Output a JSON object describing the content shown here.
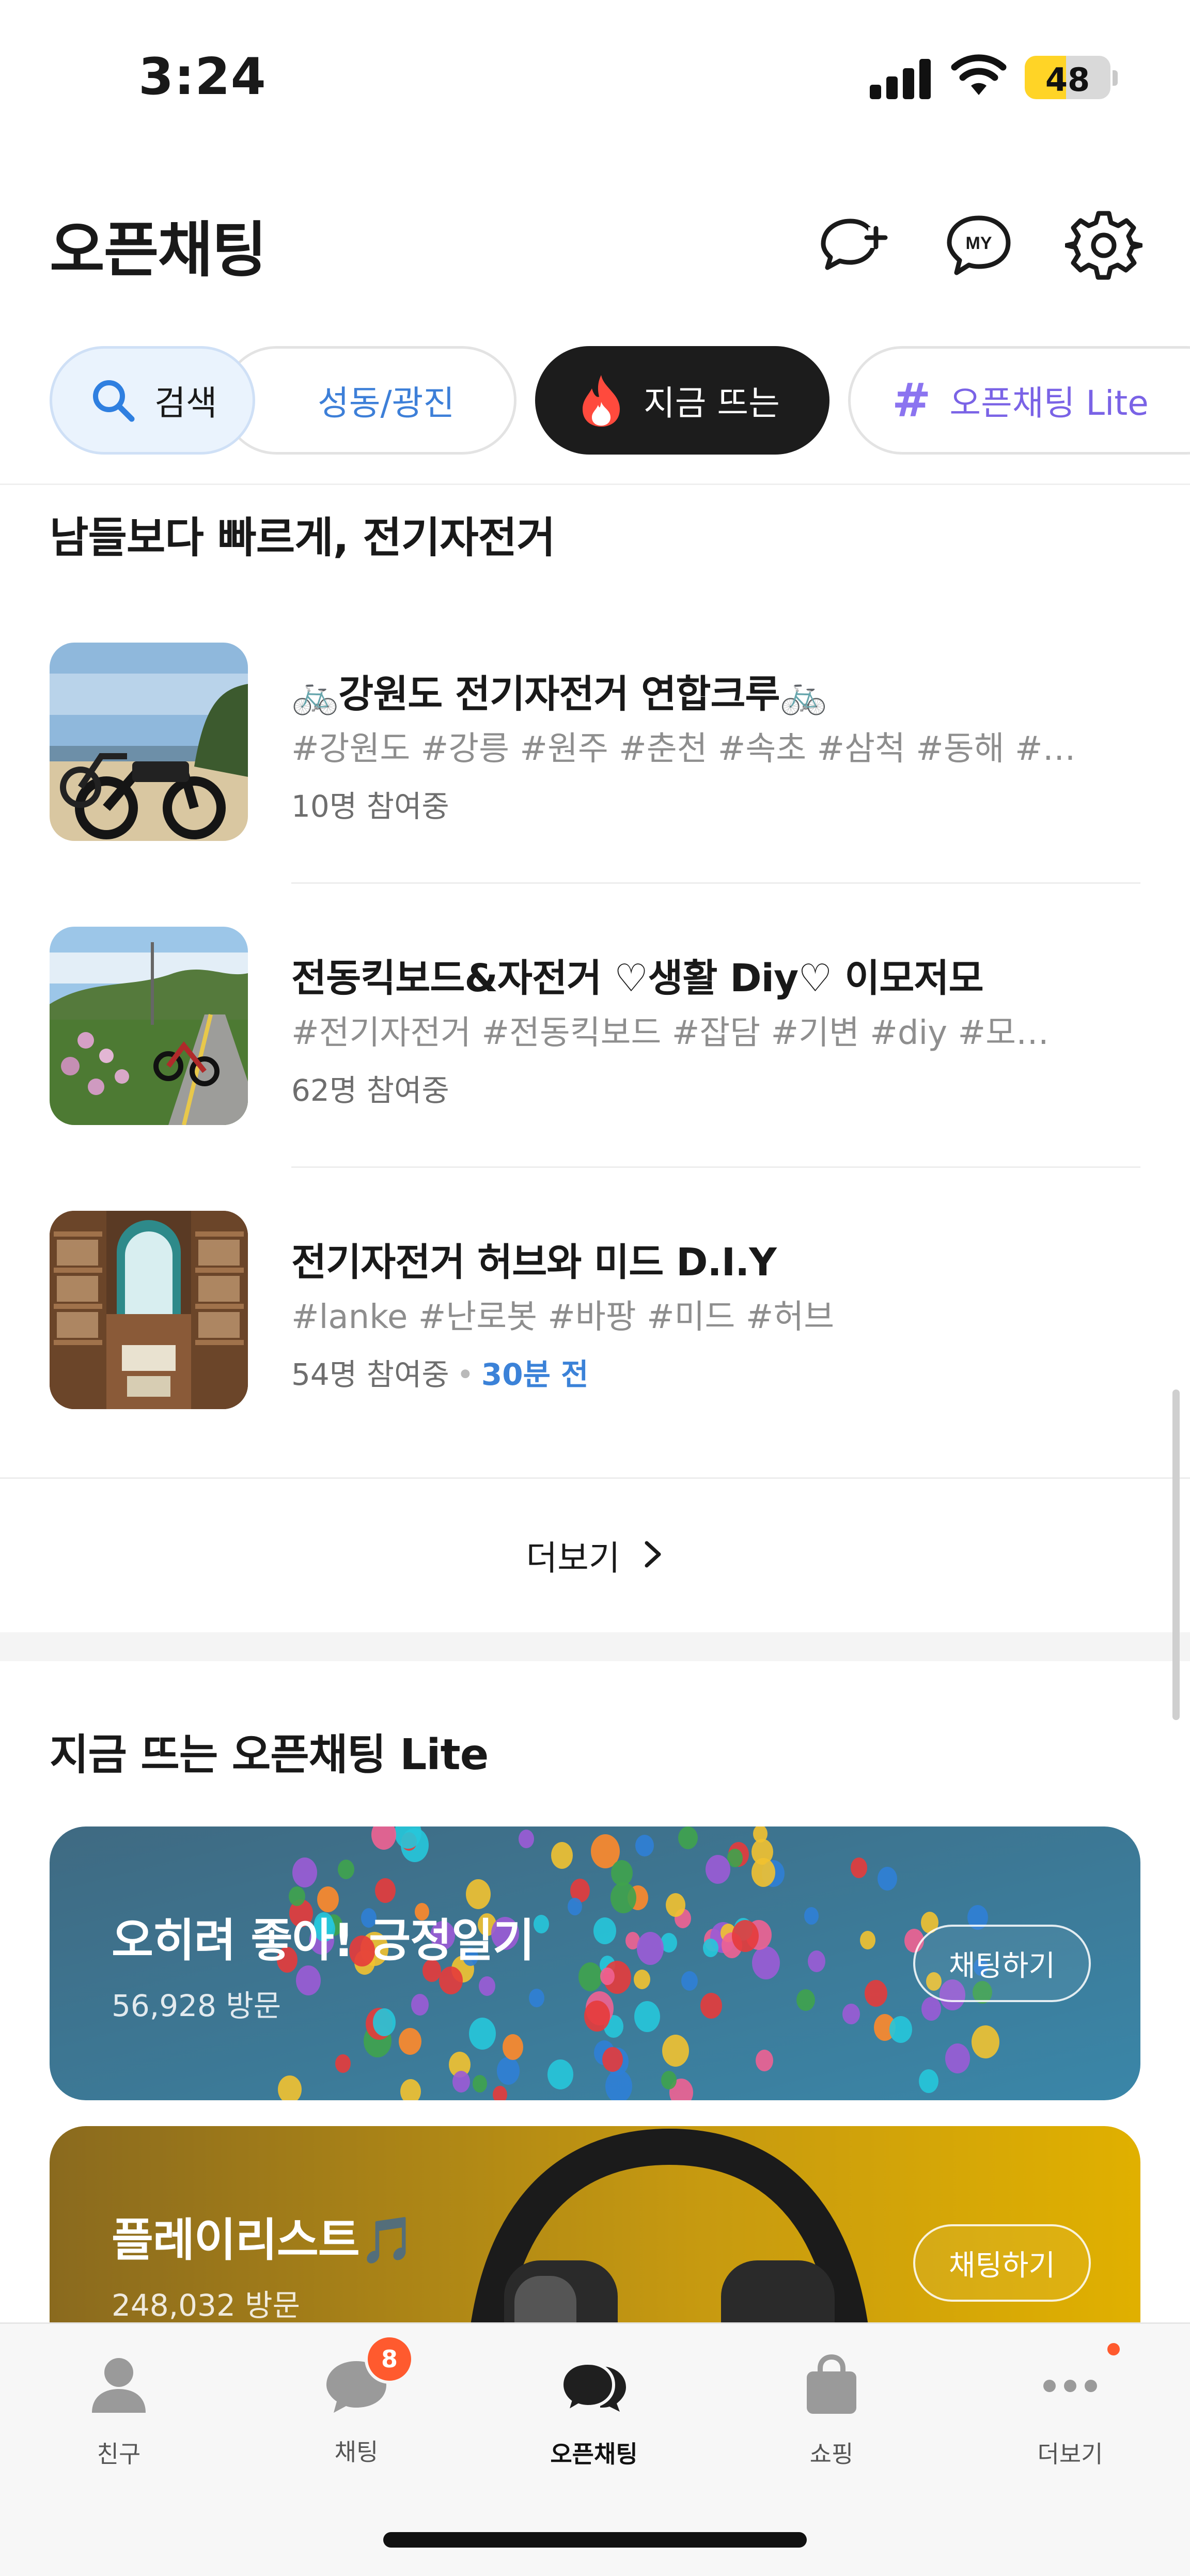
{
  "status_bar": {
    "time": "3:24",
    "battery": "48",
    "battery_level": 0.48
  },
  "header": {
    "title": "오픈채팅"
  },
  "chips": {
    "search": "검색",
    "region": "성동/광진",
    "hot": "지금 뜨는",
    "lite": "오픈채팅 Lite"
  },
  "section1": {
    "title": "남들보다 빠르게, 전기자전거",
    "rooms": [
      {
        "name": "🚲강원도 전기자전거 연합크루🚲",
        "tags": "#강원도 #강릉 #원주 #춘천 #속초 #삼척 #동해 #…",
        "members": "10명 참여중",
        "time_ago": ""
      },
      {
        "name": "전동킥보드&자전거 ♡생활 Diy♡ 이모저모",
        "tags": "#전기자전거 #전동킥보드 #잡담 #기변 #diy #모…",
        "members": "62명 참여중",
        "time_ago": ""
      },
      {
        "name": "전기자전거 허브와 미드 D.I.Y",
        "tags": "#lanke #난로봇 #바팡 #미드 #허브",
        "members": "54명 참여중",
        "time_ago": "30분 전"
      }
    ],
    "more": "더보기"
  },
  "section2": {
    "title": "지금 뜨는 오픈채팅 Lite",
    "cards": [
      {
        "title": "오히려 좋아! 긍정일기",
        "visits": "56,928 방문",
        "button": "채팅하기"
      },
      {
        "title": "플레이리스트🎵",
        "visits": "248,032 방문",
        "button": "채팅하기"
      }
    ]
  },
  "tabbar": {
    "friends": "친구",
    "chats": "채팅",
    "chats_badge": "8",
    "openchat": "오픈채팅",
    "shopping": "쇼핑",
    "more": "더보기"
  },
  "colors": {
    "accent_blue": "#3b82d8",
    "badge": "#ff5a2e",
    "hot_chip_bg": "#1c1c1c",
    "lite_purple": "#7a63e6"
  }
}
